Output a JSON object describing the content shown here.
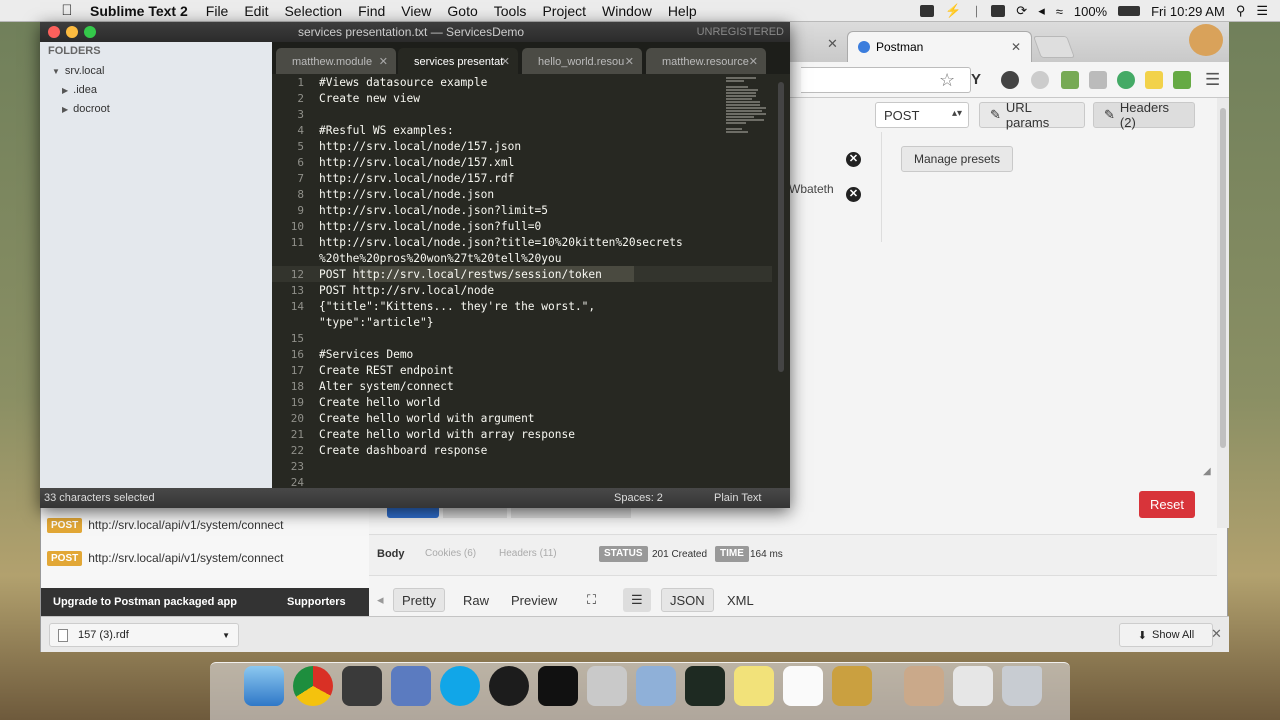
{
  "menubar": {
    "app_name": "Sublime Text 2",
    "items": [
      "File",
      "Edit",
      "Selection",
      "Find",
      "View",
      "Goto",
      "Tools",
      "Project",
      "Window",
      "Help"
    ],
    "battery": "100%",
    "clock": "Fri 10:29 AM"
  },
  "sublime": {
    "title": "services presentation.txt — ServicesDemo",
    "unregistered": "UNREGISTERED",
    "sidebar": {
      "header": "FOLDERS",
      "root": "srv.local",
      "children": [
        ".idea",
        "docroot"
      ]
    },
    "tabs": [
      {
        "label": "matthew.module",
        "active": false
      },
      {
        "label": "services presentat",
        "active": true
      },
      {
        "label": "hello_world.resou",
        "active": false
      },
      {
        "label": "matthew.resource",
        "active": false
      }
    ],
    "lines": [
      {
        "n": "1",
        "text": "#Views datasource example"
      },
      {
        "n": "2",
        "text": "Create new view"
      },
      {
        "n": "3",
        "text": ""
      },
      {
        "n": "4",
        "text": "#Resful WS examples:"
      },
      {
        "n": "5",
        "text": "http://srv.local/node/157.json"
      },
      {
        "n": "6",
        "text": "http://srv.local/node/157.xml"
      },
      {
        "n": "7",
        "text": "http://srv.local/node/157.rdf"
      },
      {
        "n": "8",
        "text": "http://srv.local/node.json"
      },
      {
        "n": "9",
        "text": "http://srv.local/node.json?limit=5"
      },
      {
        "n": "10",
        "text": "http://srv.local/node.json?full=0"
      },
      {
        "n": "11",
        "text": "http://srv.local/node.json?title=10%20kitten%20secrets"
      },
      {
        "n": "",
        "text": "%20the%20pros%20won%27t%20tell%20you"
      },
      {
        "n": "12",
        "text": "POST http://srv.local/restws/session/token"
      },
      {
        "n": "13",
        "text": "POST http://srv.local/node"
      },
      {
        "n": "14",
        "text": "{\"title\":\"Kittens... they're the worst.\","
      },
      {
        "n": "",
        "text": "\"type\":\"article\"}"
      },
      {
        "n": "15",
        "text": ""
      },
      {
        "n": "16",
        "text": "#Services Demo"
      },
      {
        "n": "17",
        "text": "Create REST endpoint"
      },
      {
        "n": "18",
        "text": "Alter system/connect"
      },
      {
        "n": "19",
        "text": "Create hello world"
      },
      {
        "n": "20",
        "text": "Create hello world with argument"
      },
      {
        "n": "21",
        "text": "Create hello world with array response"
      },
      {
        "n": "22",
        "text": "Create dashboard response"
      },
      {
        "n": "23",
        "text": ""
      },
      {
        "n": "24",
        "text": ""
      }
    ],
    "status": {
      "selection": "33 characters selected",
      "spaces": "Spaces: 2",
      "syntax": "Plain Text"
    }
  },
  "chrome": {
    "tab_title": "Postman",
    "downloads": {
      "file": "157 (3).rdf",
      "show_all": "Show All"
    }
  },
  "postman": {
    "method": "POST",
    "url_params_label": "URL params",
    "headers_label": "Headers (2)",
    "manage_presets_label": "Manage presets",
    "header_cut_text": "Wbateth",
    "reset_label": "Reset",
    "history": [
      {
        "method": "POST",
        "url": "http://srv.local/api/v1/system/connect"
      },
      {
        "method": "POST",
        "url": "http://srv.local/api/v1/system/connect"
      }
    ],
    "footer": {
      "upgrade": "Upgrade to Postman packaged app",
      "supporters": "Supporters"
    },
    "response": {
      "tabs": [
        "Body",
        "Cookies (6)",
        "Headers (11)"
      ],
      "status_label": "STATUS",
      "status_value": "201 Created",
      "time_label": "TIME",
      "time_value": "164 ms"
    },
    "view_buttons": [
      "Pretty",
      "Raw",
      "Preview",
      "JSON",
      "XML"
    ]
  }
}
